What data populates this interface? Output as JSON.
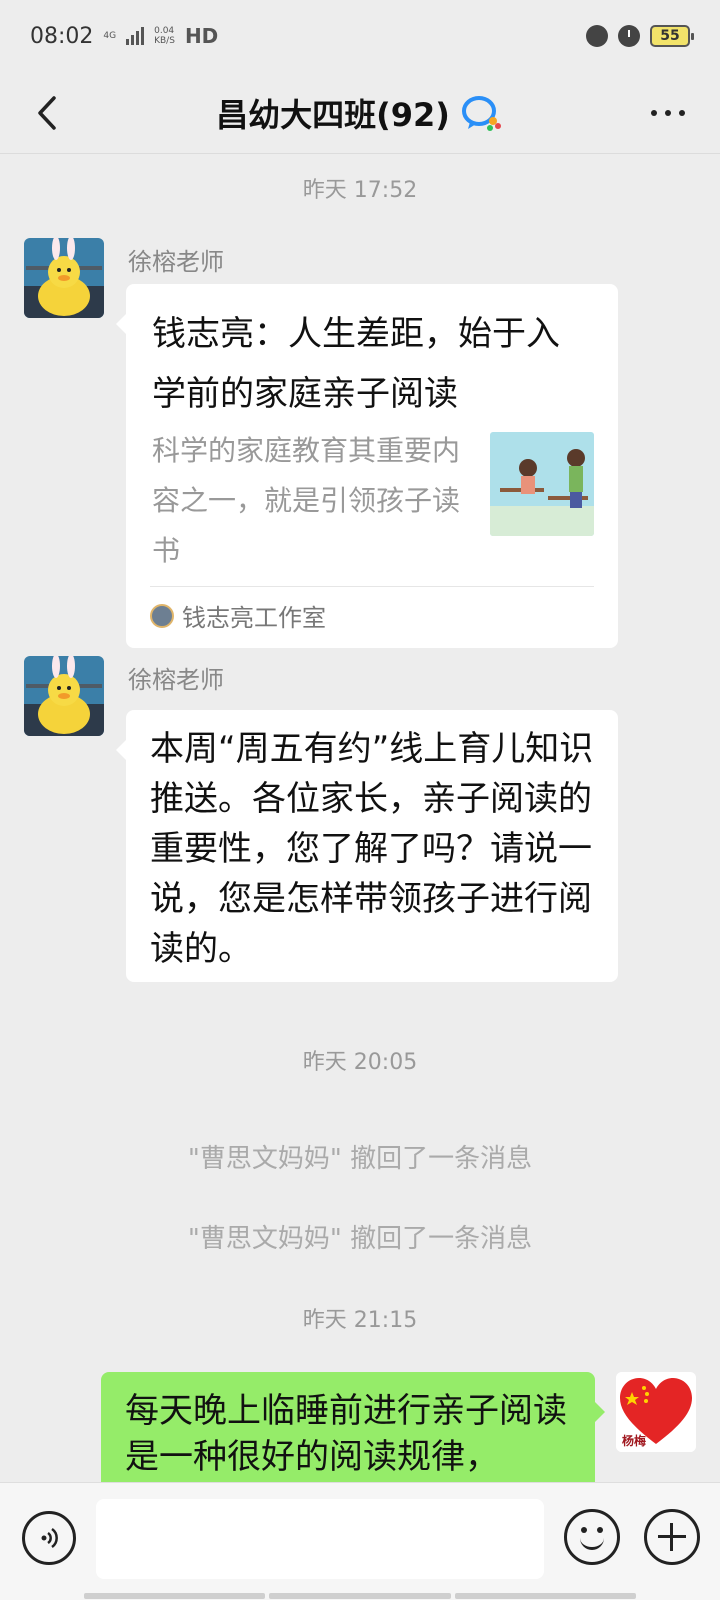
{
  "status_bar": {
    "time": "08:02",
    "network_type": "4G",
    "net_speed_value": "0.04",
    "net_speed_unit": "KB/S",
    "hd_label": "HD",
    "battery": "55"
  },
  "header": {
    "title": "昌幼大四班(92)",
    "back_icon": "chevron-left-icon",
    "more_icon": "more-dots-icon"
  },
  "messages": {
    "timestamp1": "昨天 17:52",
    "msg1": {
      "sender": "徐榕老师",
      "card_title": "钱志亮：人生差距，始于入学前的家庭亲子阅读",
      "card_desc": "科学的家庭教育其重要内容之一，就是引领孩子读书",
      "card_source": "钱志亮工作室"
    },
    "msg2": {
      "sender": "徐榕老师",
      "text": "本周“周五有约”线上育儿知识推送。各位家长，亲子阅读的重要性，您了解了吗？请说一说，您是怎样带领孩子进行阅读的。"
    },
    "timestamp2": "昨天 20:05",
    "recall1": "\"曹思文妈妈\" 撤回了一条消息",
    "recall2": "\"曹思文妈妈\" 撤回了一条消息",
    "timestamp3": "昨天 21:15",
    "msg3": {
      "text": "每天晚上临睡前进行亲子阅读是一种很好的阅读规律，",
      "avatar_label": "杨梅"
    }
  },
  "input_bar": {
    "voice_icon": "voice-icon",
    "emoji_icon": "emoji-icon",
    "plus_icon": "plus-icon",
    "input_value": ""
  },
  "colors": {
    "background": "#ededed",
    "outgoing_bubble": "#95ec69",
    "incoming_bubble": "#ffffff",
    "battery": "#f2e36a"
  }
}
